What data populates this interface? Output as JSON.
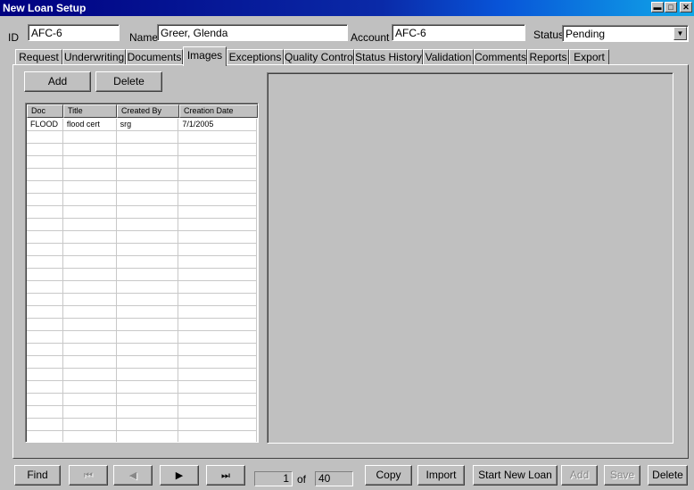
{
  "window": {
    "title": "New Loan Setup"
  },
  "header": {
    "id_label": "ID",
    "id_value": "AFC-6",
    "name_label": "Name",
    "name_value": "Greer, Glenda",
    "account_label": "Account",
    "account_value": "AFC-6",
    "status_label": "Status",
    "status_value": "Pending"
  },
  "tabs": [
    {
      "label": "Request"
    },
    {
      "label": "Underwriting"
    },
    {
      "label": "Documents"
    },
    {
      "label": "Images"
    },
    {
      "label": "Exceptions"
    },
    {
      "label": "Quality Control"
    },
    {
      "label": "Status History"
    },
    {
      "label": "Validation"
    },
    {
      "label": "Comments"
    },
    {
      "label": "Reports"
    },
    {
      "label": "Export"
    }
  ],
  "active_tab": "Images",
  "images": {
    "add_label": "Add",
    "delete_label": "Delete",
    "columns": [
      "Doc",
      "Title",
      "Created By",
      "Creation Date"
    ],
    "rows": [
      {
        "doc": "FLOOD",
        "title": "flood cert",
        "created_by": "srg",
        "creation_date": "7/1/2005"
      }
    ]
  },
  "footer": {
    "find_label": "Find",
    "first_icon": "first-record-icon",
    "prev_icon": "previous-record-icon",
    "next_icon": "next-record-icon",
    "last_icon": "last-record-icon",
    "current_record": "1",
    "of_label": "of",
    "total_records": "40",
    "copy_label": "Copy",
    "import_label": "Import",
    "start_new_loan_label": "Start New Loan",
    "add_label": "Add",
    "save_label": "Save",
    "delete_label": "Delete"
  }
}
